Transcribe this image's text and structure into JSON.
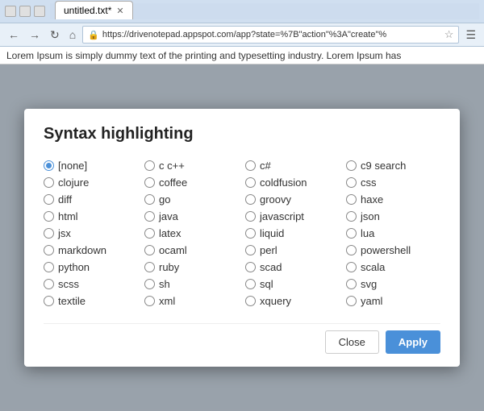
{
  "browser": {
    "title": "untitled.txt*",
    "url": "https://drivenotepad.appspot.com/app?state=%7B\"action\"%3A\"create\"%",
    "page_text": "Lorem Ipsum is simply dummy text of the printing and typesetting industry. Lorem Ipsum has"
  },
  "modal": {
    "title": "Syntax highlighting",
    "close_label": "Close",
    "apply_label": "Apply",
    "options": [
      {
        "id": "none",
        "label": "[none]",
        "selected": true
      },
      {
        "id": "c_cpp",
        "label": "c c++",
        "selected": false
      },
      {
        "id": "csharp",
        "label": "c#",
        "selected": false
      },
      {
        "id": "c9search",
        "label": "c9 search",
        "selected": false
      },
      {
        "id": "clojure",
        "label": "clojure",
        "selected": false
      },
      {
        "id": "coffee",
        "label": "coffee",
        "selected": false
      },
      {
        "id": "coldfusion",
        "label": "coldfusion",
        "selected": false
      },
      {
        "id": "css",
        "label": "css",
        "selected": false
      },
      {
        "id": "diff",
        "label": "diff",
        "selected": false
      },
      {
        "id": "go",
        "label": "go",
        "selected": false
      },
      {
        "id": "groovy",
        "label": "groovy",
        "selected": false
      },
      {
        "id": "haxe",
        "label": "haxe",
        "selected": false
      },
      {
        "id": "html",
        "label": "html",
        "selected": false
      },
      {
        "id": "java",
        "label": "java",
        "selected": false
      },
      {
        "id": "javascript",
        "label": "javascript",
        "selected": false
      },
      {
        "id": "json",
        "label": "json",
        "selected": false
      },
      {
        "id": "jsx",
        "label": "jsx",
        "selected": false
      },
      {
        "id": "latex",
        "label": "latex",
        "selected": false
      },
      {
        "id": "liquid",
        "label": "liquid",
        "selected": false
      },
      {
        "id": "lua",
        "label": "lua",
        "selected": false
      },
      {
        "id": "markdown",
        "label": "markdown",
        "selected": false
      },
      {
        "id": "ocaml",
        "label": "ocaml",
        "selected": false
      },
      {
        "id": "perl",
        "label": "perl",
        "selected": false
      },
      {
        "id": "powershell",
        "label": "powershell",
        "selected": false
      },
      {
        "id": "python",
        "label": "python",
        "selected": false
      },
      {
        "id": "ruby",
        "label": "ruby",
        "selected": false
      },
      {
        "id": "scad",
        "label": "scad",
        "selected": false
      },
      {
        "id": "scala",
        "label": "scala",
        "selected": false
      },
      {
        "id": "scss",
        "label": "scss",
        "selected": false
      },
      {
        "id": "sh",
        "label": "sh",
        "selected": false
      },
      {
        "id": "sql",
        "label": "sql",
        "selected": false
      },
      {
        "id": "svg",
        "label": "svg",
        "selected": false
      },
      {
        "id": "textile",
        "label": "textile",
        "selected": false
      },
      {
        "id": "xml",
        "label": "xml",
        "selected": false
      },
      {
        "id": "xquery",
        "label": "xquery",
        "selected": false
      },
      {
        "id": "yaml",
        "label": "yaml",
        "selected": false
      }
    ]
  }
}
